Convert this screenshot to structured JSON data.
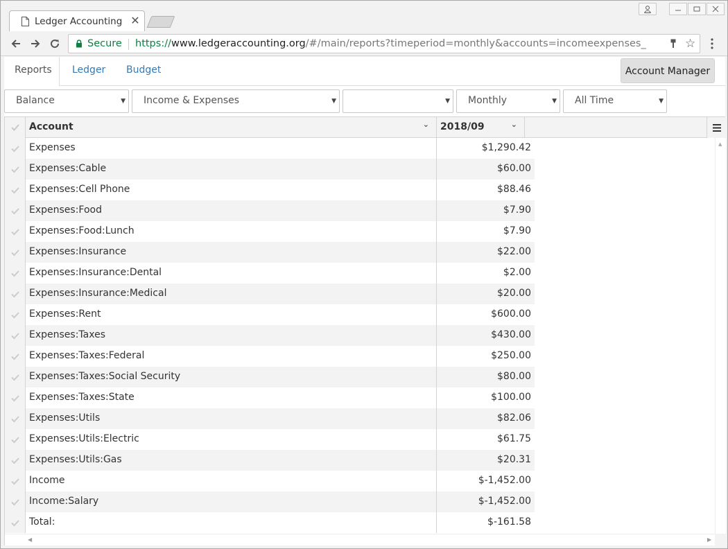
{
  "browser": {
    "tab_title": "Ledger Accounting",
    "secure_label": "Secure",
    "url_scheme": "https://",
    "url_host": "www.ledgeraccounting.org",
    "url_path": "/#/main/reports?timeperiod=monthly&accounts=incomeexpenses_"
  },
  "app_tabs": {
    "reports": "Reports",
    "ledger": "Ledger",
    "budget": "Budget"
  },
  "account_manager_label": "Account Manager",
  "filters": {
    "report_type": "Balance",
    "accounts": "Income & Expenses",
    "account_filter": "",
    "period": "Monthly",
    "range": "All Time"
  },
  "grid": {
    "columns": [
      "Account",
      "2018/09"
    ],
    "rows": [
      {
        "account": "Expenses",
        "value": "$1,290.42"
      },
      {
        "account": "Expenses:Cable",
        "value": "$60.00"
      },
      {
        "account": "Expenses:Cell Phone",
        "value": "$88.46"
      },
      {
        "account": "Expenses:Food",
        "value": "$7.90"
      },
      {
        "account": "Expenses:Food:Lunch",
        "value": "$7.90"
      },
      {
        "account": "Expenses:Insurance",
        "value": "$22.00"
      },
      {
        "account": "Expenses:Insurance:Dental",
        "value": "$2.00"
      },
      {
        "account": "Expenses:Insurance:Medical",
        "value": "$20.00"
      },
      {
        "account": "Expenses:Rent",
        "value": "$600.00"
      },
      {
        "account": "Expenses:Taxes",
        "value": "$430.00"
      },
      {
        "account": "Expenses:Taxes:Federal",
        "value": "$250.00"
      },
      {
        "account": "Expenses:Taxes:Social Security",
        "value": "$80.00"
      },
      {
        "account": "Expenses:Taxes:State",
        "value": "$100.00"
      },
      {
        "account": "Expenses:Utils",
        "value": "$82.06"
      },
      {
        "account": "Expenses:Utils:Electric",
        "value": "$61.75"
      },
      {
        "account": "Expenses:Utils:Gas",
        "value": "$20.31"
      },
      {
        "account": "Income",
        "value": "$-1,452.00"
      },
      {
        "account": "Income:Salary",
        "value": "$-1,452.00"
      },
      {
        "account": "Total:",
        "value": "$-161.58"
      }
    ]
  },
  "colors": {
    "link": "#337ab7",
    "secure_green": "#0b8043",
    "row_alt": "#f3f3f3"
  }
}
